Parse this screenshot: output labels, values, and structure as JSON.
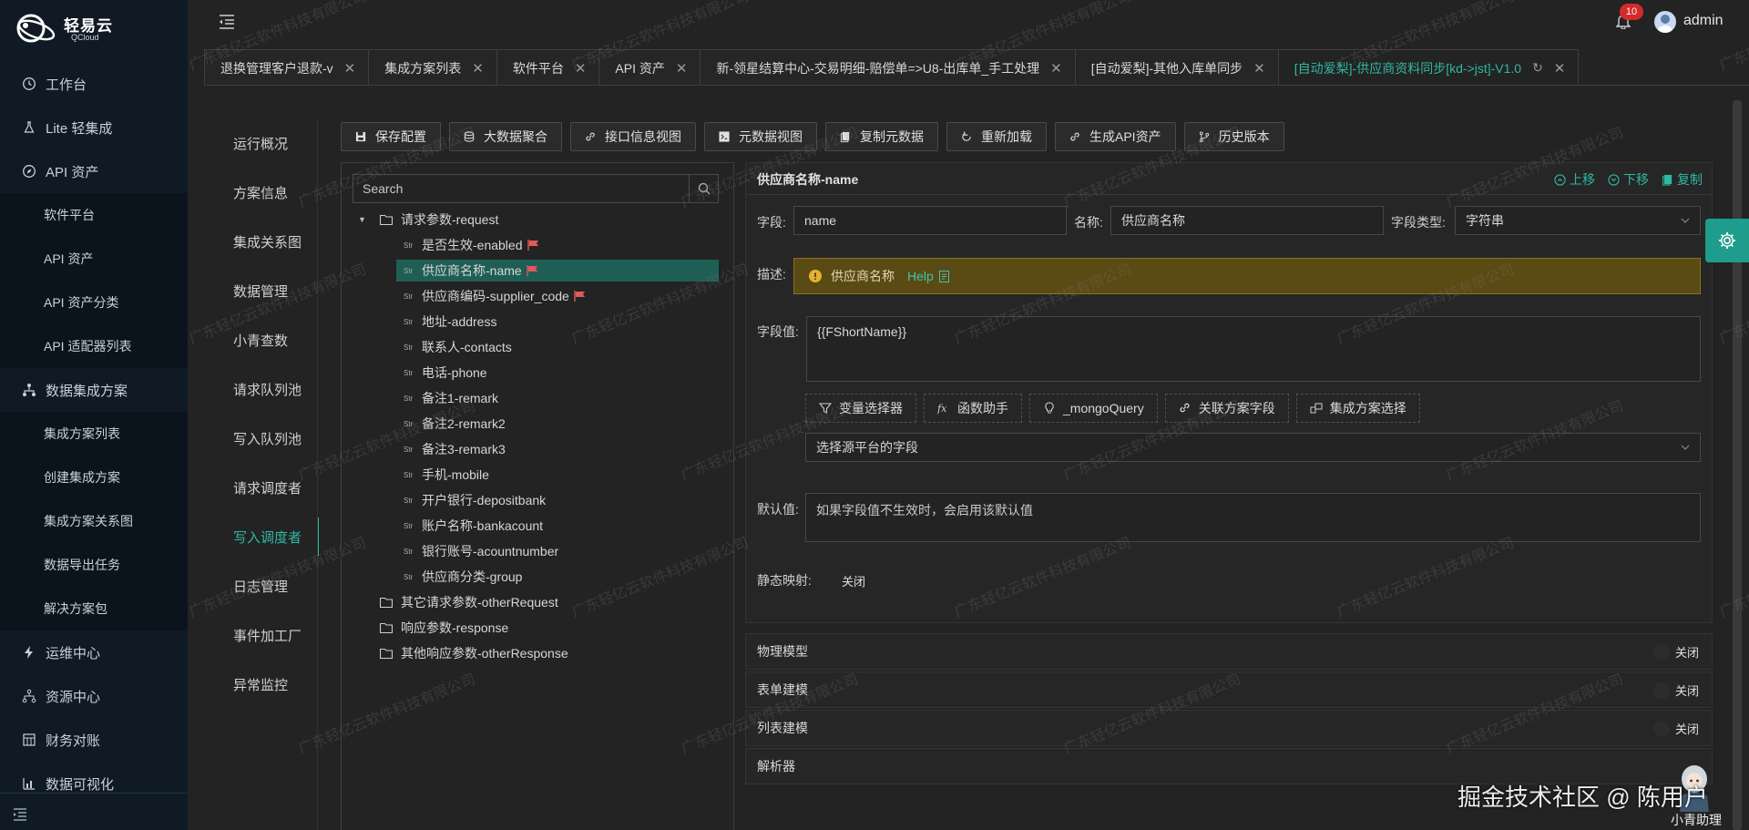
{
  "sidebar": {
    "brand": "轻易云",
    "brand_sub": "QCloud",
    "items": [
      {
        "label": "工作台",
        "icon": "clock-icon"
      },
      {
        "label": "Lite 轻集成",
        "icon": "flask-icon"
      },
      {
        "label": "API 资产",
        "icon": "compass-icon"
      },
      {
        "label": "软件平台",
        "sub": true
      },
      {
        "label": "API 资产",
        "sub": true
      },
      {
        "label": "API 资产分类",
        "sub": true
      },
      {
        "label": "API 适配器列表",
        "sub": true
      },
      {
        "label": "数据集成方案",
        "icon": "network-icon"
      },
      {
        "label": "集成方案列表",
        "sub": true
      },
      {
        "label": "创建集成方案",
        "sub": true
      },
      {
        "label": "集成方案关系图",
        "sub": true
      },
      {
        "label": "数据导出任务",
        "sub": true
      },
      {
        "label": "解决方案包",
        "sub": true
      },
      {
        "label": "运维中心",
        "icon": "bolt-icon"
      },
      {
        "label": "资源中心",
        "icon": "tree-icon"
      },
      {
        "label": "财务对账",
        "icon": "table-icon"
      },
      {
        "label": "数据可视化",
        "icon": "chart-icon"
      }
    ]
  },
  "header": {
    "notification_count": "10",
    "username": "admin"
  },
  "tabs": [
    {
      "label": "退换管理客户退款-v",
      "active": false
    },
    {
      "label": "集成方案列表",
      "active": false
    },
    {
      "label": "软件平台",
      "active": false
    },
    {
      "label": "API 资产",
      "active": false
    },
    {
      "label": "新-领星结算中心-交易明细-赔偿单=>U8-出库单_手工处理",
      "active": false
    },
    {
      "label": "[自动爱梨]-其他入库单同步",
      "active": false
    },
    {
      "label": "[自动爱梨]-供应商资料同步[kd->jst]-V1.0",
      "active": true
    }
  ],
  "section_menu": [
    {
      "label": "运行概况",
      "active": false
    },
    {
      "label": "方案信息",
      "active": false
    },
    {
      "label": "集成关系图",
      "active": false
    },
    {
      "label": "数据管理",
      "active": false
    },
    {
      "label": "小青查数",
      "active": false
    },
    {
      "label": "请求队列池",
      "active": false
    },
    {
      "label": "写入队列池",
      "active": false
    },
    {
      "label": "请求调度者",
      "active": false
    },
    {
      "label": "写入调度者",
      "active": true
    },
    {
      "label": "日志管理",
      "active": false
    },
    {
      "label": "事件加工厂",
      "active": false
    },
    {
      "label": "异常监控",
      "active": false
    }
  ],
  "toolbar": [
    {
      "label": "保存配置",
      "icon": "save-icon"
    },
    {
      "label": "大数据聚合",
      "icon": "database-icon"
    },
    {
      "label": "接口信息视图",
      "icon": "link-icon"
    },
    {
      "label": "元数据视图",
      "icon": "terminal-icon"
    },
    {
      "label": "复制元数据",
      "icon": "copy-icon"
    },
    {
      "label": "重新加载",
      "icon": "reload-icon"
    },
    {
      "label": "生成API资产",
      "icon": "link-icon"
    },
    {
      "label": "历史版本",
      "icon": "branch-icon"
    }
  ],
  "tree": {
    "search_placeholder": "Search",
    "str_badge": "Str",
    "nodes": [
      {
        "label": "请求参数-request",
        "type": "folder",
        "expanded": true,
        "level": 0
      },
      {
        "label": "是否生效-enabled",
        "type": "str",
        "flag": true,
        "level": 1
      },
      {
        "label": "供应商名称-name",
        "type": "str",
        "flag": true,
        "level": 1,
        "selected": true
      },
      {
        "label": "供应商编码-supplier_code",
        "type": "str",
        "flag": true,
        "level": 1
      },
      {
        "label": "地址-address",
        "type": "str",
        "level": 1
      },
      {
        "label": "联系人-contacts",
        "type": "str",
        "level": 1
      },
      {
        "label": "电话-phone",
        "type": "str",
        "level": 1
      },
      {
        "label": "备注1-remark",
        "type": "str",
        "level": 1
      },
      {
        "label": "备注2-remark2",
        "type": "str",
        "level": 1
      },
      {
        "label": "备注3-remark3",
        "type": "str",
        "level": 1
      },
      {
        "label": "手机-mobile",
        "type": "str",
        "level": 1
      },
      {
        "label": "开户银行-depositbank",
        "type": "str",
        "level": 1
      },
      {
        "label": "账户名称-bankacount",
        "type": "str",
        "level": 1
      },
      {
        "label": "银行账号-acountnumber",
        "type": "str",
        "level": 1
      },
      {
        "label": "供应商分类-group",
        "type": "str",
        "level": 1
      },
      {
        "label": "其它请求参数-otherRequest",
        "type": "folder",
        "level": 0
      },
      {
        "label": "响应参数-response",
        "type": "folder",
        "level": 0
      },
      {
        "label": "其他响应参数-otherResponse",
        "type": "folder",
        "level": 0
      }
    ]
  },
  "form": {
    "title": "供应商名称-name",
    "move_up": "上移",
    "move_down": "下移",
    "copy": "复制",
    "field_label": "字段:",
    "field_value": "name",
    "name_label": "名称:",
    "name_value": "供应商名称",
    "type_label": "字段类型:",
    "type_value": "字符串",
    "desc_label": "描述:",
    "desc_text": "供应商名称",
    "desc_help": "Help",
    "value_label": "字段值:",
    "value_text": "{{FShortName}}",
    "helpers": [
      {
        "label": "变量选择器",
        "icon": "filter-icon"
      },
      {
        "label": "函数助手",
        "icon": "function-icon"
      },
      {
        "label": "_mongoQuery",
        "icon": "bulb-icon"
      },
      {
        "label": "关联方案字段",
        "icon": "link-icon"
      },
      {
        "label": "集成方案选择",
        "icon": "plan-icon"
      }
    ],
    "source_field_placeholder": "选择源平台的字段",
    "default_label": "默认值:",
    "default_placeholder": "如果字段值不生效时，会启用该默认值",
    "static_map_label": "静态映射:",
    "static_map_state": "关闭"
  },
  "collapsibles": [
    {
      "label": "物理模型",
      "state": "关闭"
    },
    {
      "label": "表单建模",
      "state": "关闭"
    },
    {
      "label": "列表建模",
      "state": "关闭"
    },
    {
      "label": "解析器",
      "state": ""
    }
  ],
  "assistant_label": "小青助理",
  "credit": "掘金技术社区 @ 陈用户",
  "watermark": "广东轻亿云软件科技有限公司",
  "colors": {
    "accent": "#2fb7a3",
    "sidebar_bg": "#0f1a24",
    "warning_bg": "#5a4a14",
    "badge": "#d42a2a"
  }
}
